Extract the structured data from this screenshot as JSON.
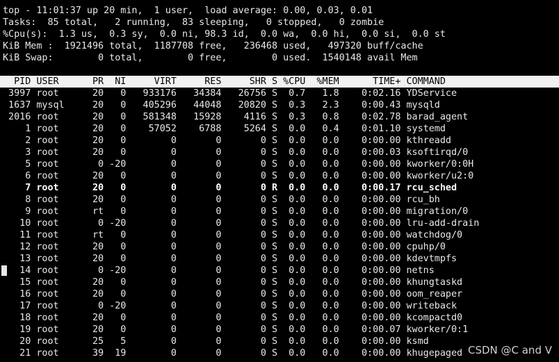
{
  "summary": {
    "line1": "top - 11:01:37 up 20 min,  1 user,  load average: 0.00, 0.03, 0.01",
    "line2": "Tasks:  85 total,   2 running,  83 sleeping,   0 stopped,   0 zombie",
    "line3": "%Cpu(s):  1.3 us,  0.3 sy,  0.0 ni, 98.3 id,  0.0 wa,  0.0 hi,  0.0 si,  0.0 st",
    "line4": "KiB Mem :  1921496 total,  1187708 free,   236468 used,   497320 buff/cache",
    "line5": "KiB Swap:        0 total,        0 free,        0 used.  1540148 avail Mem"
  },
  "table": {
    "columns": [
      "PID",
      "USER",
      "PR",
      "NI",
      "VIRT",
      "RES",
      "SHR",
      "S",
      "%CPU",
      "%MEM",
      "TIME+",
      "COMMAND"
    ],
    "rows": [
      [
        "3997",
        "root",
        "20",
        "0",
        "933176",
        "34384",
        "26756",
        "S",
        "0.7",
        "1.8",
        "0:02.16",
        "YDService"
      ],
      [
        "1637",
        "mysql",
        "20",
        "0",
        "405296",
        "44048",
        "20820",
        "S",
        "0.3",
        "2.3",
        "0:00.43",
        "mysqld"
      ],
      [
        "2016",
        "root",
        "20",
        "0",
        "581348",
        "15928",
        "4116",
        "S",
        "0.3",
        "0.8",
        "0:02.78",
        "barad_agent"
      ],
      [
        "1",
        "root",
        "20",
        "0",
        "57052",
        "6788",
        "5264",
        "S",
        "0.0",
        "0.4",
        "0:01.10",
        "systemd"
      ],
      [
        "2",
        "root",
        "20",
        "0",
        "0",
        "0",
        "0",
        "S",
        "0.0",
        "0.0",
        "0:00.00",
        "kthreadd"
      ],
      [
        "3",
        "root",
        "20",
        "0",
        "0",
        "0",
        "0",
        "S",
        "0.0",
        "0.0",
        "0:00.03",
        "ksoftirqd/0"
      ],
      [
        "5",
        "root",
        "0",
        "-20",
        "0",
        "0",
        "0",
        "S",
        "0.0",
        "0.0",
        "0:00.00",
        "kworker/0:0H"
      ],
      [
        "6",
        "root",
        "20",
        "0",
        "0",
        "0",
        "0",
        "S",
        "0.0",
        "0.0",
        "0:00.00",
        "kworker/u2:0"
      ],
      [
        "7",
        "root",
        "20",
        "0",
        "0",
        "0",
        "0",
        "R",
        "0.0",
        "0.0",
        "0:00.17",
        "rcu_sched"
      ],
      [
        "8",
        "root",
        "20",
        "0",
        "0",
        "0",
        "0",
        "S",
        "0.0",
        "0.0",
        "0:00.00",
        "rcu_bh"
      ],
      [
        "9",
        "root",
        "rt",
        "0",
        "0",
        "0",
        "0",
        "S",
        "0.0",
        "0.0",
        "0:00.00",
        "migration/0"
      ],
      [
        "10",
        "root",
        "0",
        "-20",
        "0",
        "0",
        "0",
        "S",
        "0.0",
        "0.0",
        "0:00.00",
        "lru-add-drain"
      ],
      [
        "11",
        "root",
        "rt",
        "0",
        "0",
        "0",
        "0",
        "S",
        "0.0",
        "0.0",
        "0:00.00",
        "watchdog/0"
      ],
      [
        "12",
        "root",
        "20",
        "0",
        "0",
        "0",
        "0",
        "S",
        "0.0",
        "0.0",
        "0:00.00",
        "cpuhp/0"
      ],
      [
        "13",
        "root",
        "20",
        "0",
        "0",
        "0",
        "0",
        "S",
        "0.0",
        "0.0",
        "0:00.00",
        "kdevtmpfs"
      ],
      [
        "14",
        "root",
        "0",
        "-20",
        "0",
        "0",
        "0",
        "S",
        "0.0",
        "0.0",
        "0:00.00",
        "netns"
      ],
      [
        "15",
        "root",
        "20",
        "0",
        "0",
        "0",
        "0",
        "S",
        "0.0",
        "0.0",
        "0:00.00",
        "khungtaskd"
      ],
      [
        "16",
        "root",
        "20",
        "0",
        "0",
        "0",
        "0",
        "S",
        "0.0",
        "0.0",
        "0:00.00",
        "oom_reaper"
      ],
      [
        "17",
        "root",
        "0",
        "-20",
        "0",
        "0",
        "0",
        "S",
        "0.0",
        "0.0",
        "0:00.00",
        "writeback"
      ],
      [
        "18",
        "root",
        "20",
        "0",
        "0",
        "0",
        "0",
        "S",
        "0.0",
        "0.0",
        "0:00.00",
        "kcompactd0"
      ],
      [
        "19",
        "root",
        "20",
        "0",
        "0",
        "0",
        "0",
        "S",
        "0.0",
        "0.0",
        "0:00.07",
        "kworker/0:1"
      ],
      [
        "20",
        "root",
        "25",
        "5",
        "0",
        "0",
        "0",
        "S",
        "0.0",
        "0.0",
        "0:00.00",
        "ksmd"
      ],
      [
        "21",
        "root",
        "39",
        "19",
        "0",
        "0",
        "0",
        "S",
        "0.0",
        "0.0",
        "0:00.00",
        "khugepaged"
      ]
    ],
    "highlighted_pid": "7"
  },
  "watermark": "CSDN @C and V",
  "colors": {
    "background": "#000000",
    "text": "#e8e8e8",
    "header_bg": "#f2f2f2",
    "header_text": "#000000"
  }
}
